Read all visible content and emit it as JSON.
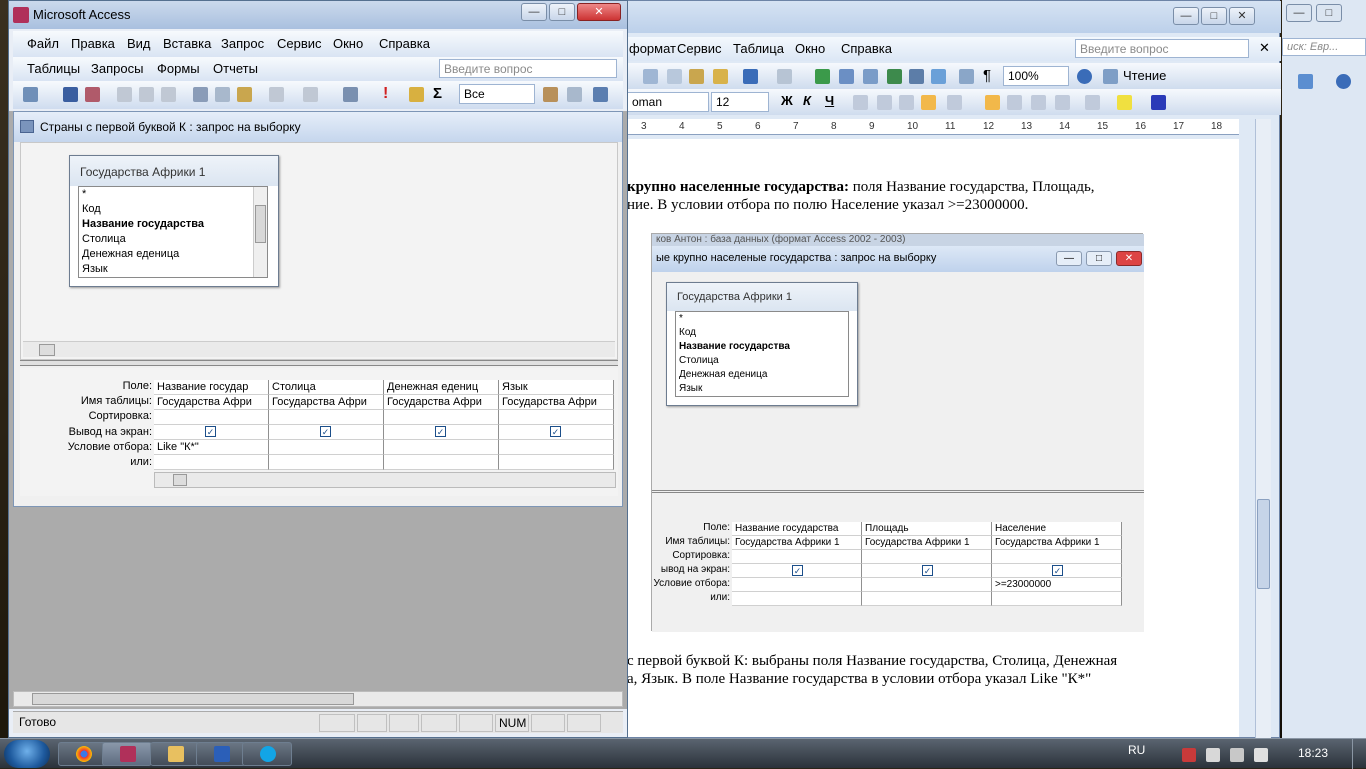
{
  "access": {
    "title": "Microsoft Access",
    "menu": [
      "Файл",
      "Правка",
      "Вид",
      "Вставка",
      "Запрос",
      "Сервис",
      "Окно",
      "Справка"
    ],
    "menu2": [
      "Таблицы",
      "Запросы",
      "Формы",
      "Отчеты"
    ],
    "ask_placeholder": "Введите вопрос",
    "toolbar_combo": "Все",
    "query_title": "Страны с первой буквой К : запрос на выборку",
    "table": {
      "title": "Государства Африки 1",
      "fields": [
        "*",
        "Код",
        "Название государства",
        "Столица",
        "Денежная еденица",
        "Язык"
      ]
    },
    "grid": {
      "row_labels": [
        "Поле:",
        "Имя таблицы:",
        "Сортировка:",
        "Вывод на экран:",
        "Условие отбора:",
        "или:"
      ],
      "columns": [
        {
          "field": "Название государ",
          "table": "Государства Афри",
          "criteria": "Like \"К*\""
        },
        {
          "field": "Столица",
          "table": "Государства Афри",
          "criteria": ""
        },
        {
          "field": "Денежная едениц",
          "table": "Государства Афри",
          "criteria": ""
        },
        {
          "field": "Язык",
          "table": "Государства Афри",
          "criteria": ""
        }
      ]
    },
    "status": "Готово",
    "num": "NUM"
  },
  "word": {
    "menu": [
      "формат",
      "Сервис",
      "Таблица",
      "Окно",
      "Справка"
    ],
    "ask_placeholder": "Введите вопрос",
    "zoom": "100%",
    "reading": "Чтение",
    "font": "oman",
    "size": "12",
    "ruler": [
      "3",
      "4",
      "5",
      "6",
      "7",
      "8",
      "9",
      "10",
      "11",
      "12",
      "13",
      "14",
      "15",
      "16",
      "17",
      "18"
    ],
    "text1a": "крупно населенные государства:",
    "text1b": " поля Название государства, Площадь,",
    "text2": "ние. В условии отбора по полю Население указал >=23000000.",
    "text3": "с первой буквой К: выбраны поля Название государства, Столица, Денежная",
    "text4": "а, Язык. В поле Название государства в условии отбора указал Like \"К*\"",
    "side_search": "иск: Евр..."
  },
  "embedded": {
    "db_title": "ков Антон : база данных (формат Access 2002 - 2003)",
    "query_title": "ые крупно населеные государства : запрос на выборку",
    "table_title": "Государства Африки 1",
    "fields": [
      "*",
      "Код",
      "Название государства",
      "Столица",
      "Денежная еденица",
      "Язык"
    ],
    "row_labels": [
      "Поле:",
      "Имя таблицы:",
      "Сортировка:",
      "ывод на экран:",
      "Условие отбора:",
      "или:"
    ],
    "columns": [
      {
        "field": "Название государства",
        "table": "Государства Африки 1",
        "criteria": ""
      },
      {
        "field": "Площадь",
        "table": "Государства Африки 1",
        "criteria": ""
      },
      {
        "field": "Население",
        "table": "Государства Африки 1",
        "criteria": ">=23000000"
      }
    ]
  },
  "taskbar": {
    "lang": "RU",
    "time": "18:23"
  }
}
